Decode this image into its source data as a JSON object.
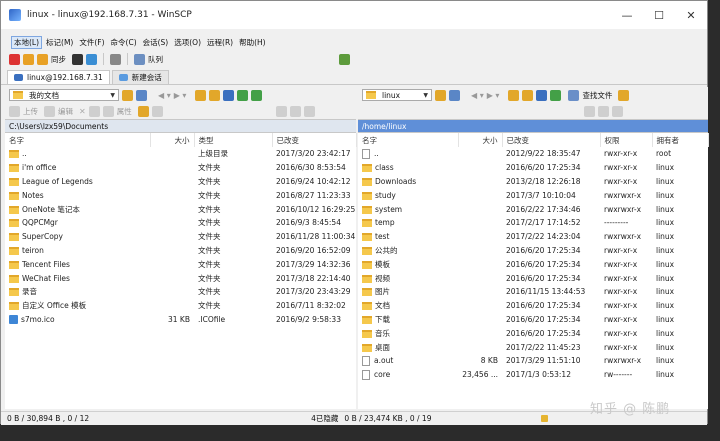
{
  "window": {
    "title": "linux - linux@192.168.7.31 - WinSCP",
    "minimize": "—",
    "maximize": "☐",
    "close": "✕"
  },
  "menu": [
    "本地(L)",
    "标记(M)",
    "文件(F)",
    "命令(C)",
    "会话(S)",
    "选项(O)",
    "远程(R)",
    "帮助(H)"
  ],
  "toolbar": {
    "sync_label": "同步",
    "queue_label": "队列"
  },
  "tabs": [
    {
      "label": "linux@192.168.7.31"
    },
    {
      "label": "新建会话"
    }
  ],
  "left_pane": {
    "drive": "我的文档",
    "actions": {
      "upload": "上传",
      "edit": "编辑",
      "props": "属性"
    },
    "path": "C:\\Users\\lzx59\\Documents",
    "columns": {
      "name": "名字",
      "size": "大小",
      "type": "类型",
      "modified": "已改变"
    },
    "rows": [
      {
        "name": "..",
        "size": "",
        "type": "上级目录",
        "modified": "2017/3/20  23:42:17",
        "icon": "folder"
      },
      {
        "name": "i'm office",
        "size": "",
        "type": "文件夹",
        "modified": "2016/6/30  8:53:54",
        "icon": "folder"
      },
      {
        "name": "League of Legends",
        "size": "",
        "type": "文件夹",
        "modified": "2016/9/24  10:42:12",
        "icon": "folder"
      },
      {
        "name": "Notes",
        "size": "",
        "type": "文件夹",
        "modified": "2016/8/27  11:23:33",
        "icon": "folder"
      },
      {
        "name": "OneNote 笔记本",
        "size": "",
        "type": "文件夹",
        "modified": "2016/10/12  16:29:25",
        "icon": "folder"
      },
      {
        "name": "QQPCMgr",
        "size": "",
        "type": "文件夹",
        "modified": "2016/9/3  8:45:54",
        "icon": "folder"
      },
      {
        "name": "SuperCopy",
        "size": "",
        "type": "文件夹",
        "modified": "2016/11/28  11:00:34",
        "icon": "folder"
      },
      {
        "name": "teiron",
        "size": "",
        "type": "文件夹",
        "modified": "2016/9/20  16:52:09",
        "icon": "folder"
      },
      {
        "name": "Tencent Files",
        "size": "",
        "type": "文件夹",
        "modified": "2017/3/29  14:32:36",
        "icon": "folder"
      },
      {
        "name": "WeChat Files",
        "size": "",
        "type": "文件夹",
        "modified": "2017/3/18  22:14:40",
        "icon": "folder"
      },
      {
        "name": "录音",
        "size": "",
        "type": "文件夹",
        "modified": "2017/3/20  23:43:29",
        "icon": "folder"
      },
      {
        "name": "自定义 Office 模板",
        "size": "",
        "type": "文件夹",
        "modified": "2016/7/11  8:32:02",
        "icon": "folder"
      },
      {
        "name": "s7mo.ico",
        "size": "31 KB",
        "type": ".ICOfile",
        "modified": "2016/9/2  9:58:33",
        "icon": "ico"
      }
    ],
    "status": "0 B / 30,894 B , 0 / 12",
    "hidden": "4已隐藏"
  },
  "right_pane": {
    "drive": "linux",
    "find_label": "查找文件",
    "path": "/home/linux",
    "columns": {
      "name": "名字",
      "size": "大小",
      "modified": "已改变",
      "perms": "权限",
      "owner": "拥有者"
    },
    "rows": [
      {
        "name": "..",
        "size": "",
        "modified": "2012/9/22 18:35:47",
        "perms": "rwxr-xr-x",
        "owner": "root",
        "icon": "file"
      },
      {
        "name": "class",
        "size": "",
        "modified": "2016/6/20 17:25:34",
        "perms": "rwxr-xr-x",
        "owner": "linux",
        "icon": "folder"
      },
      {
        "name": "Downloads",
        "size": "",
        "modified": "2013/2/18 12:26:18",
        "perms": "rwxr-xr-x",
        "owner": "linux",
        "icon": "folder"
      },
      {
        "name": "study",
        "size": "",
        "modified": "2017/3/7 10:10:04",
        "perms": "rwxrwxr-x",
        "owner": "linux",
        "icon": "folder"
      },
      {
        "name": "system",
        "size": "",
        "modified": "2016/2/22 17:34:46",
        "perms": "rwxrwxr-x",
        "owner": "linux",
        "icon": "folder"
      },
      {
        "name": "temp",
        "size": "",
        "modified": "2017/2/17 17:14:52",
        "perms": "---------",
        "owner": "linux",
        "icon": "folder"
      },
      {
        "name": "test",
        "size": "",
        "modified": "2017/2/22 14:23:04",
        "perms": "rwxrwxr-x",
        "owner": "linux",
        "icon": "folder"
      },
      {
        "name": "公共的",
        "size": "",
        "modified": "2016/6/20 17:25:34",
        "perms": "rwxr-xr-x",
        "owner": "linux",
        "icon": "folder"
      },
      {
        "name": "模板",
        "size": "",
        "modified": "2016/6/20 17:25:34",
        "perms": "rwxr-xr-x",
        "owner": "linux",
        "icon": "folder"
      },
      {
        "name": "视频",
        "size": "",
        "modified": "2016/6/20 17:25:34",
        "perms": "rwxr-xr-x",
        "owner": "linux",
        "icon": "folder"
      },
      {
        "name": "图片",
        "size": "",
        "modified": "2016/11/15 13:44:53",
        "perms": "rwxr-xr-x",
        "owner": "linux",
        "icon": "folder"
      },
      {
        "name": "文档",
        "size": "",
        "modified": "2016/6/20 17:25:34",
        "perms": "rwxr-xr-x",
        "owner": "linux",
        "icon": "folder"
      },
      {
        "name": "下载",
        "size": "",
        "modified": "2016/6/20 17:25:34",
        "perms": "rwxr-xr-x",
        "owner": "linux",
        "icon": "folder"
      },
      {
        "name": "音乐",
        "size": "",
        "modified": "2016/6/20 17:25:34",
        "perms": "rwxr-xr-x",
        "owner": "linux",
        "icon": "folder"
      },
      {
        "name": "桌面",
        "size": "",
        "modified": "2017/2/22 11:45:23",
        "perms": "rwxr-xr-x",
        "owner": "linux",
        "icon": "folder"
      },
      {
        "name": "a.out",
        "size": "8 KB",
        "modified": "2017/3/29 11:51:10",
        "perms": "rwxrwxr-x",
        "owner": "linux",
        "icon": "file"
      },
      {
        "name": "core",
        "size": "23,456 ...",
        "modified": "2017/1/3 0:53:12",
        "perms": "rw-------",
        "owner": "linux",
        "icon": "file"
      }
    ],
    "status": "0 B / 23,474 KB , 0 / 19"
  },
  "watermark": "知乎 @ 陈鹏"
}
